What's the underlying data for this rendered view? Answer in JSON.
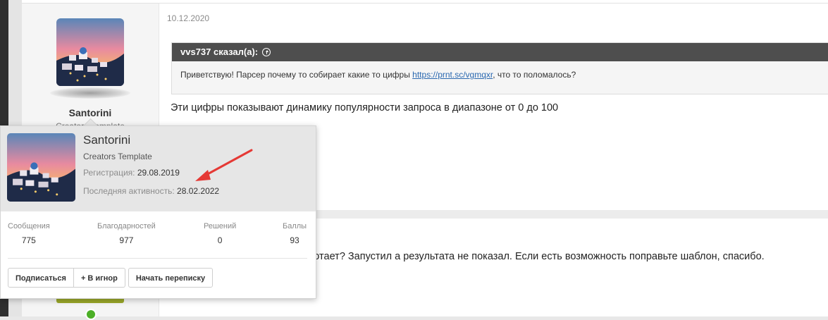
{
  "post1": {
    "date": "10.12.2020",
    "author": {
      "name": "Santorini",
      "title": "Creators Template"
    },
    "quote": {
      "header": "vvs737 сказал(а):",
      "text_before": "Приветствую! Парсер почему то собирает какие то цифры ",
      "link": "https://prnt.sc/vgmqxr",
      "text_after": ", что то поломалось?"
    },
    "body": "Эти цифры показывают динамику популярности запроса в диапазоне от 0 до 100"
  },
  "post2": {
    "body_visible": "ботает? Запустил а результата не показал. Если есть возможность поправьте шаблон, спасибо."
  },
  "popup": {
    "name": "Santorini",
    "title": "Creators Template",
    "registration_label": "Регистрация:",
    "registration_value": "29.08.2019",
    "activity_label": "Последняя активность:",
    "activity_value": "28.02.2022",
    "stats": [
      {
        "label": "Сообщения",
        "value": "775"
      },
      {
        "label": "Благодарностей",
        "value": "977"
      },
      {
        "label": "Решений",
        "value": "0"
      },
      {
        "label": "Баллы",
        "value": "93"
      }
    ],
    "buttons": {
      "subscribe": "Подписаться",
      "ignore": "+ В игнор",
      "message": "Начать переписку"
    }
  },
  "colors": {
    "quote_header": "#4e4e4e",
    "link": "#2a68b0",
    "annotation_arrow": "#e53935",
    "online": "#4caf27",
    "accent_button": "#9aa829"
  },
  "icons": {
    "quote_jump": "circle-arrow-up-icon",
    "annotation": "red-arrow-annotation"
  }
}
